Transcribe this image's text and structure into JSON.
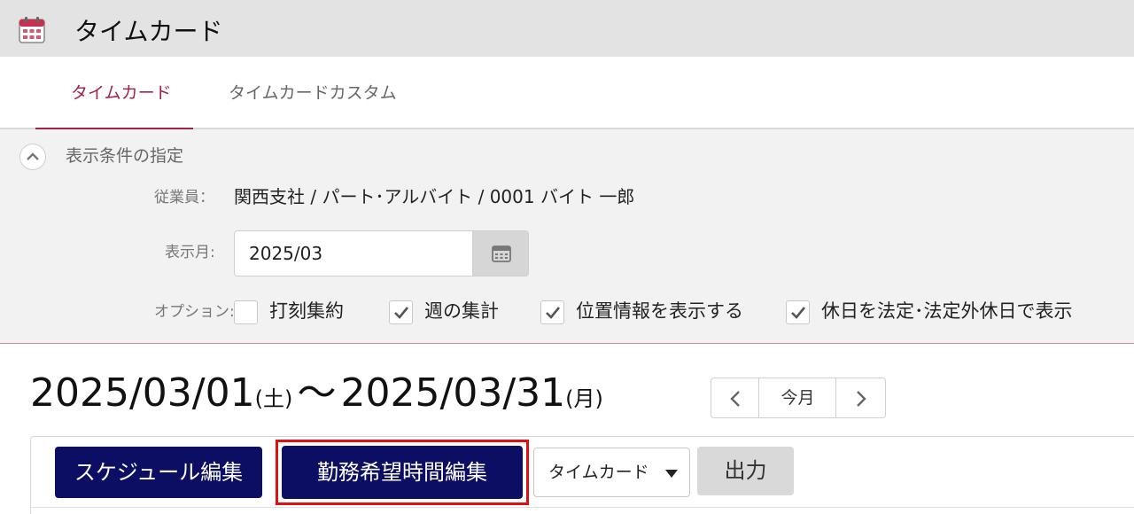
{
  "header": {
    "title": "タイムカード",
    "icon": "calendar-icon"
  },
  "tabs": [
    {
      "label": "タイムカード",
      "active": true
    },
    {
      "label": "タイムカードカスタム",
      "active": false
    }
  ],
  "filter": {
    "title": "表示条件の指定",
    "employee_label": "従業員：",
    "employee_value": "関西支社 / パート･アルバイト / 0001 バイト 一郎",
    "month_label": "表示月:",
    "month_value": "2025/03",
    "options_label": "オプション:",
    "options": [
      {
        "label": "打刻集約",
        "checked": false
      },
      {
        "label": "週の集計",
        "checked": true
      },
      {
        "label": "位置情報を表示する",
        "checked": true
      },
      {
        "label": "休日を法定･法定外休日で表示",
        "checked": true
      }
    ]
  },
  "range": {
    "start_date": "2025/03/01",
    "start_dow": "(土)",
    "separator": "〜",
    "end_date": "2025/03/31",
    "end_dow": "(月)"
  },
  "pager": {
    "today_label": "今月"
  },
  "toolbar": {
    "schedule_edit_label": "スケジュール編集",
    "preferred_hours_edit_label": "勤務希望時間編集",
    "view_select_value": "タイムカード",
    "output_label": "出力"
  },
  "colors": {
    "accent": "#a3204e",
    "navy_button": "#0b0e62",
    "highlight": "#e01010"
  }
}
